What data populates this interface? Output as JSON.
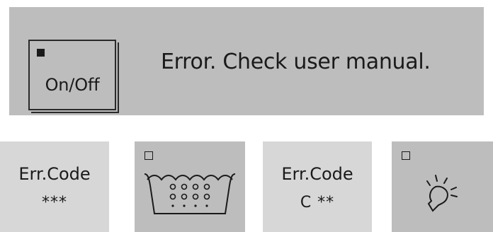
{
  "panel": {
    "power_label": "On/Off",
    "message": "Error. Check user manual."
  },
  "tiles": [
    {
      "line1": "Err.Code",
      "line2": "***"
    },
    {
      "icon": "basin-icon"
    },
    {
      "line1": "Err.Code",
      "line2": "C **"
    },
    {
      "icon": "lightbulb-icon"
    }
  ],
  "colors": {
    "panel_bg": "#bdbdbd",
    "tile_light": "#d7d7d7",
    "text": "#1a1a1a"
  }
}
